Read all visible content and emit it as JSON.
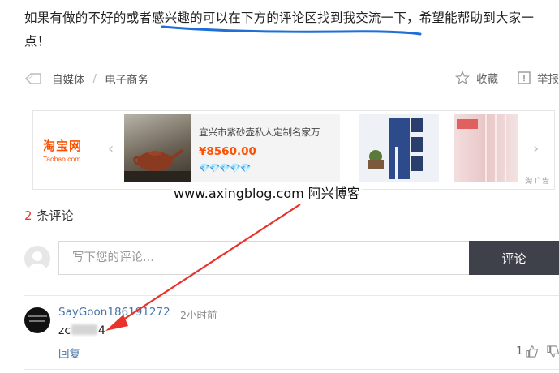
{
  "article": {
    "paragraph_part1": "如果有做的不好的或者",
    "paragraph_part2": "感兴趣的可以在下方的评论区找到我交流一下",
    "paragraph_part3": "，希望能帮助到大家一点！"
  },
  "tags": {
    "items": [
      "自媒体",
      "电子商务"
    ],
    "separator": "/"
  },
  "actions": {
    "favorite": "收藏",
    "report": "举报"
  },
  "ad": {
    "logo_cn": "淘宝网",
    "logo_en": "Taobao.com",
    "product_name": "宜兴市紫砂壶私人定制名家万",
    "price": "¥8560.00",
    "diamonds": "💎💎💎💎💎",
    "ad_label": "淘 广告"
  },
  "watermark": "www.axingblog.com 阿兴博客",
  "comments": {
    "count": "2",
    "title_suffix": "条评论",
    "input_placeholder": "写下您的评论...",
    "submit_label": "评论",
    "items": [
      {
        "author": "SayGoon186191272",
        "time": "2小时前",
        "text_prefix": "zc",
        "text_suffix": "4",
        "reply_label": "回复",
        "likes": "1"
      }
    ]
  },
  "colors": {
    "accent_blue": "#4a76a8",
    "comment_count_red": "#e53935",
    "button_dark": "#3e4149",
    "taobao_orange": "#ff5000",
    "annotation_red": "#e8322a",
    "highlight_blue": "#1f6fd6"
  }
}
